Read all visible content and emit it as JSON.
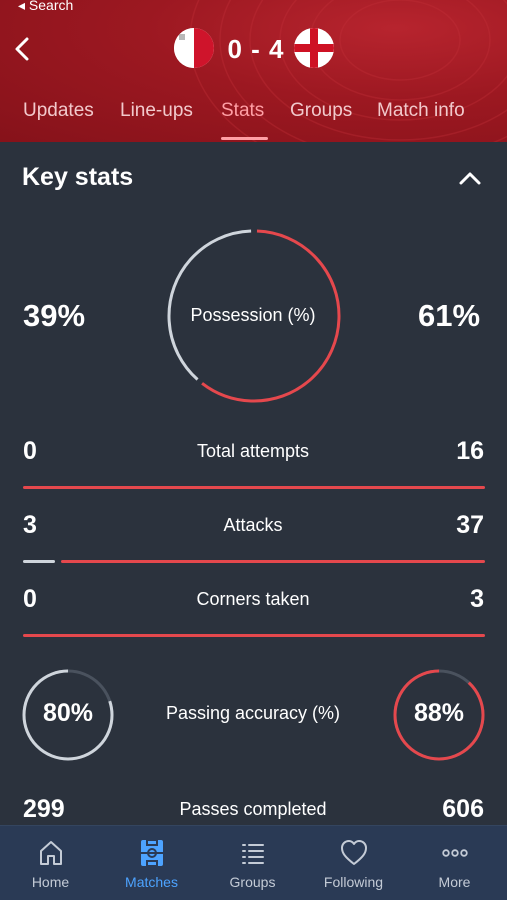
{
  "status_bar": {
    "back_label": "◂ Search"
  },
  "match": {
    "home_team_flag": "malta-flag",
    "away_team_flag": "england-flag",
    "score": "0 - 4"
  },
  "tabs": [
    {
      "label": "Updates",
      "active": false
    },
    {
      "label": "Line-ups",
      "active": false
    },
    {
      "label": "Stats",
      "active": true
    },
    {
      "label": "Groups",
      "active": false
    },
    {
      "label": "Match info",
      "active": false
    }
  ],
  "key_stats": {
    "title": "Key stats",
    "possession": {
      "label": "Possession (%)",
      "home": "39%",
      "away": "61%",
      "home_fraction": 0.39,
      "away_fraction": 0.61
    },
    "rows": [
      {
        "label": "Total attempts",
        "home": "0",
        "away": "16",
        "home_value": 0,
        "away_value": 16
      },
      {
        "label": "Attacks",
        "home": "3",
        "away": "37",
        "home_value": 3,
        "away_value": 37
      },
      {
        "label": "Corners taken",
        "home": "0",
        "away": "3",
        "home_value": 0,
        "away_value": 3
      }
    ],
    "passing_accuracy": {
      "label": "Passing accuracy (%)",
      "home": "80%",
      "away": "88%",
      "home_fraction": 0.8,
      "away_fraction": 0.88
    },
    "passes_completed": {
      "label": "Passes completed",
      "home": "299",
      "away": "606"
    }
  },
  "colors": {
    "home": "#cfd5dc",
    "away": "#e5484d",
    "header": "#9c1821",
    "active_nav": "#4da3ff"
  },
  "bottom_nav": [
    {
      "label": "Home",
      "icon": "home-icon",
      "active": false
    },
    {
      "label": "Matches",
      "icon": "pitch-icon",
      "active": true
    },
    {
      "label": "Groups",
      "icon": "list-icon",
      "active": false
    },
    {
      "label": "Following",
      "icon": "heart-icon",
      "active": false
    },
    {
      "label": "More",
      "icon": "more-icon",
      "active": false
    }
  ]
}
